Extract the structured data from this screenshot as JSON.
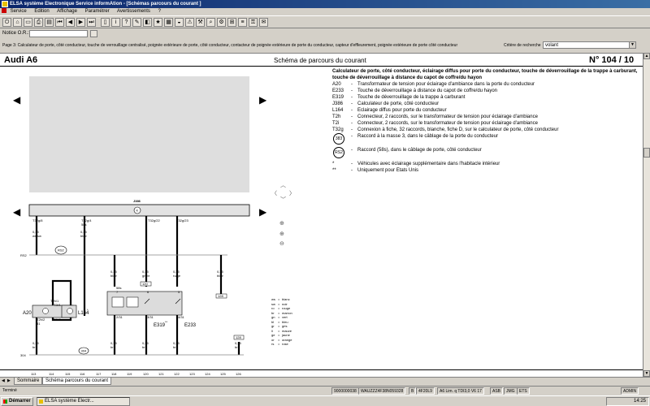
{
  "window": {
    "title": "ELSA système Electronique Service informAtion - [Schémas parcours du courant ]"
  },
  "menu": {
    "items": [
      "Service",
      "Edition",
      "Affichage",
      "Paramétrer",
      "Avertissements",
      "?"
    ]
  },
  "filter": {
    "label": "Notice O.R.:",
    "value": ""
  },
  "page_description": "Page 3: Calculateur de porte, côté conducteur, touche de verrouillage centralisé, poignée extérieure de porte, côté conducteur, contacteur de poignée extérieure de porte du conducteur, capteur d'effleurement, poignée extérieure de porte côté conducteur",
  "search": {
    "label": "Critère de recherche",
    "value": "volant"
  },
  "document": {
    "model": "Audi A6",
    "title": "Schéma de parcours du courant",
    "number": "N°  104 / 10"
  },
  "legend": {
    "intro": "Calculateur de porte, côté conducteur, éclairage diffus pour porte du conducteur, touche de déverrouillage de la trappe à carburant, touche de déverrouillage à distance du capot de coffre/du hayon",
    "items": [
      {
        "code": "A20",
        "text": "Transformateur de tension pour éclairage d'ambiance dans la porte du conducteur"
      },
      {
        "code": "E233",
        "text": "Touche de déverrouillage à distance du capot de coffre/du hayon"
      },
      {
        "code": "E319",
        "text": "Touche de déverrouillage de la trappe à carburant"
      },
      {
        "code": "J386",
        "text": "Calculateur de porte, côté conducteur"
      },
      {
        "code": "L164",
        "text": "Eclairage diffus pour porte du conducteur"
      },
      {
        "code": "T2h",
        "text": "Connecteur, 2 raccords, sur le transformateur de tension pour éclairage d'ambiance"
      },
      {
        "code": "T2i",
        "text": "Connecteur, 2 raccords, sur le transformateur de tension pour éclairage d'ambiance"
      },
      {
        "code": "T32g",
        "text": "Connexion à fiche, 32 raccords, blanche, fiche D, sur le calculateur de porte, côté conducteur"
      }
    ],
    "circle_items": [
      {
        "code": "383",
        "text": "Raccord à la masse 3, dans le câblage de la porte du conducteur"
      },
      {
        "code": "RS2",
        "text": "Raccord (58s), dans le câblage de porte, côté conducteur"
      }
    ],
    "notes": [
      {
        "code": "*",
        "text": "Véhicules avec éclairage supplémentaire dans l'habitacle intérieur"
      },
      {
        "code": "**",
        "text": "Uniquement pour Etats Unis"
      }
    ]
  },
  "diagram": {
    "j386_label": "J386",
    "ground_label": "K",
    "pins": [
      "T32g/8",
      "T32g/4",
      "T32g/22",
      "T32g/23"
    ],
    "pin2_sub": "58s",
    "wires_top": [
      {
        "size": "0,35",
        "color": "ws/sw"
      },
      {
        "size": "0,35",
        "color": "bl/br"
      }
    ],
    "bus_label": "RS2",
    "bus_circle": "RS2",
    "wires_mid": [
      {
        "size": "0,35",
        "color": "bl/br"
      },
      {
        "size": "0,35",
        "color": "gn/br"
      },
      {
        "size": "0,35",
        "color": "ro/ge"
      },
      {
        "size": "0,35",
        "color": "bl/br"
      }
    ],
    "circ_120": "120",
    "circ_128": "128",
    "sw_pins": [
      "58s",
      "7",
      "6",
      "5"
    ],
    "sw_bottom": [
      "2/31",
      "3/31",
      "4/31"
    ],
    "a20": {
      "label": "A20",
      "t_top1": "T2h/1",
      "t_top2": "T2i/1",
      "t_bot1": "T2h/2",
      "t_bot2": "T2i/2",
      "wsub": "31"
    },
    "l164": {
      "label": "L164",
      "mark": "*"
    },
    "e319": {
      "label": "E319",
      "mark": "**"
    },
    "e233": {
      "label": "E233"
    },
    "wires_bot": [
      {
        "size": "0,35",
        "color": "br"
      },
      {
        "size": "0,35",
        "color": "br"
      },
      {
        "size": "0,35",
        "color": "br"
      },
      {
        "size": "0,35",
        "color": "br"
      },
      {
        "size": "0,35",
        "color": "br"
      }
    ],
    "ground_bus": "304",
    "ground_circle": "304",
    "ruler": [
      "113",
      "114",
      "115",
      "116",
      "117",
      "118",
      "119",
      "120",
      "121",
      "122",
      "123",
      "124",
      "125",
      "126"
    ]
  },
  "color_codes": [
    {
      "k": "ws",
      "v": "blanc"
    },
    {
      "k": "sw",
      "v": "noir"
    },
    {
      "k": "ro",
      "v": "rouge"
    },
    {
      "k": "br",
      "v": "marron"
    },
    {
      "k": "gn",
      "v": "vert"
    },
    {
      "k": "bl",
      "v": "bleu"
    },
    {
      "k": "gr",
      "v": "gris"
    },
    {
      "k": "li",
      "v": "mauve"
    },
    {
      "k": "ge",
      "v": "jaune"
    },
    {
      "k": "or",
      "v": "orange"
    },
    {
      "k": "rs",
      "v": "rose"
    }
  ],
  "tabs": {
    "items": [
      "Sommaire",
      "Schéma parcours du courant"
    ]
  },
  "status": {
    "state": "Terminé",
    "cells": [
      "9000000038",
      "WAUZZZ4F38N059328",
      "B",
      "4F20L9",
      "A6 Lim. q TDI3,0 V6 17",
      "ASB",
      "JMG",
      "ETS",
      "ADMIN"
    ]
  },
  "taskbar": {
    "start": "Démarrer",
    "task": "ELSA système Electr...",
    "clock": "14:25"
  }
}
